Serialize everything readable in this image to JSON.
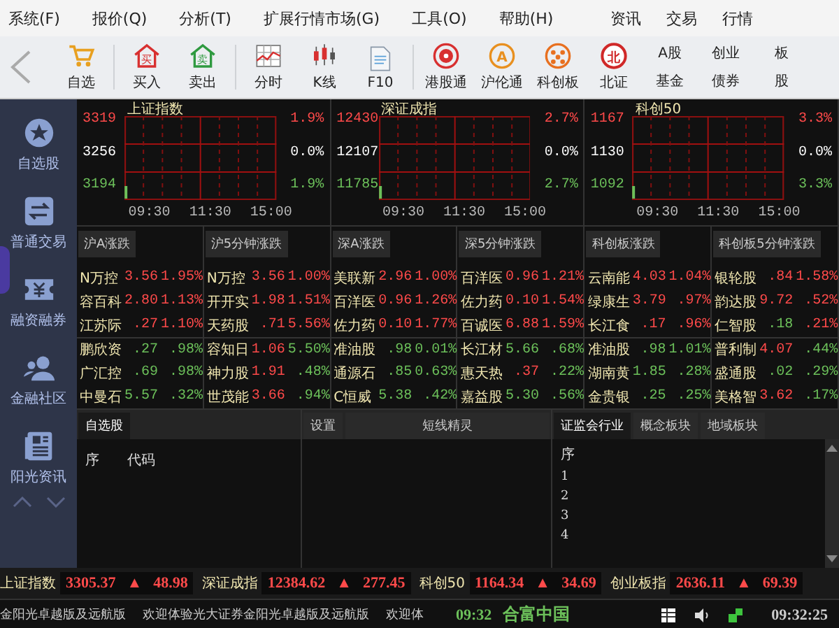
{
  "menu": {
    "items": [
      "系统(F)",
      "报价(Q)",
      "分析(T)",
      "扩展行情市场(G)",
      "工具(O)",
      "帮助(H)"
    ],
    "right_items": [
      "资讯",
      "交易",
      "行情"
    ]
  },
  "toolbar": [
    {
      "kind": "cart",
      "label": "自选"
    },
    {
      "kind": "sep"
    },
    {
      "kind": "buy",
      "label": "买入",
      "glyph": "买"
    },
    {
      "kind": "sell",
      "label": "卖出",
      "glyph": "卖"
    },
    {
      "kind": "sep"
    },
    {
      "kind": "minute",
      "label": "分时"
    },
    {
      "kind": "candle",
      "label": "K线"
    },
    {
      "kind": "doc",
      "label": "F10"
    },
    {
      "kind": "sep"
    },
    {
      "kind": "hk",
      "label": "港股通"
    },
    {
      "kind": "ring",
      "label": "沪伦通",
      "glyph": "A"
    },
    {
      "kind": "dots",
      "label": "科创板"
    },
    {
      "kind": "ring_red",
      "label": "北证",
      "glyph": "北"
    },
    {
      "kind": "text",
      "lines": [
        "A股",
        "基金"
      ]
    },
    {
      "kind": "text",
      "lines": [
        "创业",
        "债券"
      ]
    },
    {
      "kind": "text",
      "lines": [
        "板",
        "股"
      ]
    }
  ],
  "sidebar": [
    {
      "label": "自选股"
    },
    {
      "label": "普通交易"
    },
    {
      "label": "融资融券"
    },
    {
      "label": "金融社区"
    },
    {
      "label": "阳光资讯"
    }
  ],
  "charts": [
    {
      "title": "上证指数",
      "high": "3319",
      "mid": "3256",
      "low": "3194",
      "pct_high": "1.9%",
      "pct_mid": "0.0%",
      "pct_low": "1.9%",
      "times": [
        "09:30",
        "11:30",
        "15:00"
      ]
    },
    {
      "title": "深证成指",
      "high": "12430",
      "mid": "12107",
      "low": "11785",
      "pct_high": "2.7%",
      "pct_mid": "0.0%",
      "pct_low": "2.7%",
      "times": [
        "09:30",
        "11:30",
        "15:00"
      ]
    },
    {
      "title": "科创50",
      "high": "1167",
      "mid": "1130",
      "low": "1092",
      "pct_high": "3.3%",
      "pct_mid": "0.0%",
      "pct_low": "3.3%",
      "times": [
        "09:30",
        "11:30",
        "15:00"
      ]
    }
  ],
  "rankings": [
    {
      "title": "沪A涨跌",
      "rows": [
        {
          "name": "N万控",
          "price": {
            "text": "3.56",
            "color": "#ff4a4a"
          },
          "change": {
            "text": "1.95%",
            "color": "#ff4a4a"
          }
        },
        {
          "name": "容百科",
          "price": {
            "text": "2.80",
            "color": "#ff4a4a"
          },
          "change": {
            "text": "1.13%",
            "color": "#ff4a4a"
          }
        },
        {
          "name": "江苏际",
          "price": {
            "text": ".27",
            "color": "#ff4a4a"
          },
          "change": {
            "text": "1.10%",
            "color": "#ff4a4a"
          }
        },
        {
          "name": "鹏欣资",
          "price": {
            "text": ".27",
            "color": "#6cc05a"
          },
          "change": {
            "text": ".98%",
            "color": "#6cc05a"
          }
        },
        {
          "name": "广汇控",
          "price": {
            "text": ".69",
            "color": "#6cc05a"
          },
          "change": {
            "text": ".98%",
            "color": "#6cc05a"
          }
        },
        {
          "name": "中曼石",
          "price": {
            "text": "5.57",
            "color": "#6cc05a"
          },
          "change": {
            "text": ".32%",
            "color": "#6cc05a"
          }
        }
      ]
    },
    {
      "title": "沪5分钟涨跌",
      "rows": [
        {
          "name": "N万控",
          "price": {
            "text": "3.56",
            "color": "#ff4a4a"
          },
          "change": {
            "text": "1.00%",
            "color": "#ff4a4a"
          }
        },
        {
          "name": "开开实",
          "price": {
            "text": "1.98",
            "color": "#ff4a4a"
          },
          "change": {
            "text": "1.51%",
            "color": "#ff4a4a"
          }
        },
        {
          "name": "天药股",
          "price": {
            "text": ".71",
            "color": "#ff4a4a"
          },
          "change": {
            "text": "5.56%",
            "color": "#ff4a4a"
          }
        },
        {
          "name": "容知日",
          "price": {
            "text": "1.06",
            "color": "#ff4a4a"
          },
          "change": {
            "text": "5.50%",
            "color": "#6cc05a"
          }
        },
        {
          "name": "神力股",
          "price": {
            "text": "1.91",
            "color": "#ff4a4a"
          },
          "change": {
            "text": ".48%",
            "color": "#6cc05a"
          }
        },
        {
          "name": "世茂能",
          "price": {
            "text": "3.66",
            "color": "#ff4a4a"
          },
          "change": {
            "text": ".94%",
            "color": "#6cc05a"
          }
        }
      ]
    },
    {
      "title": "深A涨跌",
      "rows": [
        {
          "name": "美联新",
          "price": {
            "text": "2.96",
            "color": "#ff4a4a"
          },
          "change": {
            "text": "1.00%",
            "color": "#ff4a4a"
          }
        },
        {
          "name": "百洋医",
          "price": {
            "text": "0.96",
            "color": "#ff4a4a"
          },
          "change": {
            "text": "1.26%",
            "color": "#ff4a4a"
          }
        },
        {
          "name": "佐力药",
          "price": {
            "text": "0.10",
            "color": "#ff4a4a"
          },
          "change": {
            "text": "1.77%",
            "color": "#ff4a4a"
          }
        },
        {
          "name": "准油股",
          "price": {
            "text": ".98",
            "color": "#6cc05a"
          },
          "change": {
            "text": "0.01%",
            "color": "#6cc05a"
          }
        },
        {
          "name": "通源石",
          "price": {
            "text": ".85",
            "color": "#6cc05a"
          },
          "change": {
            "text": "0.63%",
            "color": "#6cc05a"
          }
        },
        {
          "name": "C恒威",
          "price": {
            "text": "5.38",
            "color": "#6cc05a"
          },
          "change": {
            "text": ".42%",
            "color": "#6cc05a"
          }
        }
      ]
    },
    {
      "title": "深5分钟涨跌",
      "rows": [
        {
          "name": "百洋医",
          "price": {
            "text": "0.96",
            "color": "#ff4a4a"
          },
          "change": {
            "text": "1.21%",
            "color": "#ff4a4a"
          }
        },
        {
          "name": "佐力药",
          "price": {
            "text": "0.10",
            "color": "#ff4a4a"
          },
          "change": {
            "text": "1.54%",
            "color": "#ff4a4a"
          }
        },
        {
          "name": "百诚医",
          "price": {
            "text": "6.88",
            "color": "#ff4a4a"
          },
          "change": {
            "text": "1.59%",
            "color": "#ff4a4a"
          }
        },
        {
          "name": "长江材",
          "price": {
            "text": "5.66",
            "color": "#6cc05a"
          },
          "change": {
            "text": ".68%",
            "color": "#6cc05a"
          }
        },
        {
          "name": "惠天热",
          "price": {
            "text": ".37",
            "color": "#ff4a4a"
          },
          "change": {
            "text": ".22%",
            "color": "#6cc05a"
          }
        },
        {
          "name": "嘉益股",
          "price": {
            "text": "5.30",
            "color": "#6cc05a"
          },
          "change": {
            "text": ".56%",
            "color": "#6cc05a"
          }
        }
      ]
    },
    {
      "title": "科创板涨跌",
      "rows": [
        {
          "name": "云南能",
          "price": {
            "text": "4.03",
            "color": "#ff4a4a"
          },
          "change": {
            "text": "1.04%",
            "color": "#ff4a4a"
          }
        },
        {
          "name": "绿康生",
          "price": {
            "text": "3.79",
            "color": "#ff4a4a"
          },
          "change": {
            "text": ".97%",
            "color": "#ff4a4a"
          }
        },
        {
          "name": "长江食",
          "price": {
            "text": ".17",
            "color": "#ff4a4a"
          },
          "change": {
            "text": ".96%",
            "color": "#ff4a4a"
          }
        },
        {
          "name": "准油股",
          "price": {
            "text": ".98",
            "color": "#6cc05a"
          },
          "change": {
            "text": "1.01%",
            "color": "#6cc05a"
          }
        },
        {
          "name": "湖南黄",
          "price": {
            "text": "1.85",
            "color": "#6cc05a"
          },
          "change": {
            "text": ".28%",
            "color": "#6cc05a"
          }
        },
        {
          "name": "金贵银",
          "price": {
            "text": ".25",
            "color": "#6cc05a"
          },
          "change": {
            "text": ".25%",
            "color": "#6cc05a"
          }
        }
      ]
    },
    {
      "title": "科创板5分钟涨跌",
      "rows": [
        {
          "name": "银轮股",
          "price": {
            "text": ".84",
            "color": "#ff4a4a"
          },
          "change": {
            "text": "1.58%",
            "color": "#ff4a4a"
          }
        },
        {
          "name": "韵达股",
          "price": {
            "text": "9.72",
            "color": "#ff4a4a"
          },
          "change": {
            "text": ".52%",
            "color": "#ff4a4a"
          }
        },
        {
          "name": "仁智股",
          "price": {
            "text": ".18",
            "color": "#6cc05a"
          },
          "change": {
            "text": ".21%",
            "color": "#ff4a4a"
          }
        },
        {
          "name": "普利制",
          "price": {
            "text": "4.07",
            "color": "#ff4a4a"
          },
          "change": {
            "text": ".44%",
            "color": "#6cc05a"
          }
        },
        {
          "name": "盛通股",
          "price": {
            "text": ".02",
            "color": "#6cc05a"
          },
          "change": {
            "text": ".29%",
            "color": "#6cc05a"
          }
        },
        {
          "name": "美格智",
          "price": {
            "text": "3.62",
            "color": "#ff4a4a"
          },
          "change": {
            "text": ".17%",
            "color": "#6cc05a"
          }
        }
      ]
    }
  ],
  "watchlist": {
    "tab": "自选股",
    "columns": [
      "序",
      "代码"
    ]
  },
  "sprite": {
    "tabs": [
      "设置",
      "短线精灵"
    ]
  },
  "sectors": {
    "tabs": [
      {
        "label": "证监会行业",
        "selected": true
      },
      {
        "label": "概念板块",
        "selected": false
      },
      {
        "label": "地域板块",
        "selected": false
      }
    ],
    "header": "序",
    "rows": [
      "1",
      "2",
      "3",
      "4"
    ]
  },
  "ticker": [
    {
      "name": "上证指数",
      "value": "3305.37",
      "arrow": "▲",
      "change": "48.98"
    },
    {
      "name": "深证成指",
      "value": "12384.62",
      "arrow": "▲",
      "change": "277.45"
    },
    {
      "name": "科创50",
      "value": "1164.34",
      "arrow": "▲",
      "change": "34.69"
    },
    {
      "name": "创业板指",
      "value": "2636.11",
      "arrow": "▲",
      "change": "69.39"
    }
  ],
  "status": {
    "messages": [
      "金阳光卓越版及远航版",
      "欢迎体验光大证券金阳光卓越版及远航版",
      "欢迎体"
    ],
    "time": "09:32",
    "brand": "合富中国",
    "clock": "09:32:25"
  }
}
